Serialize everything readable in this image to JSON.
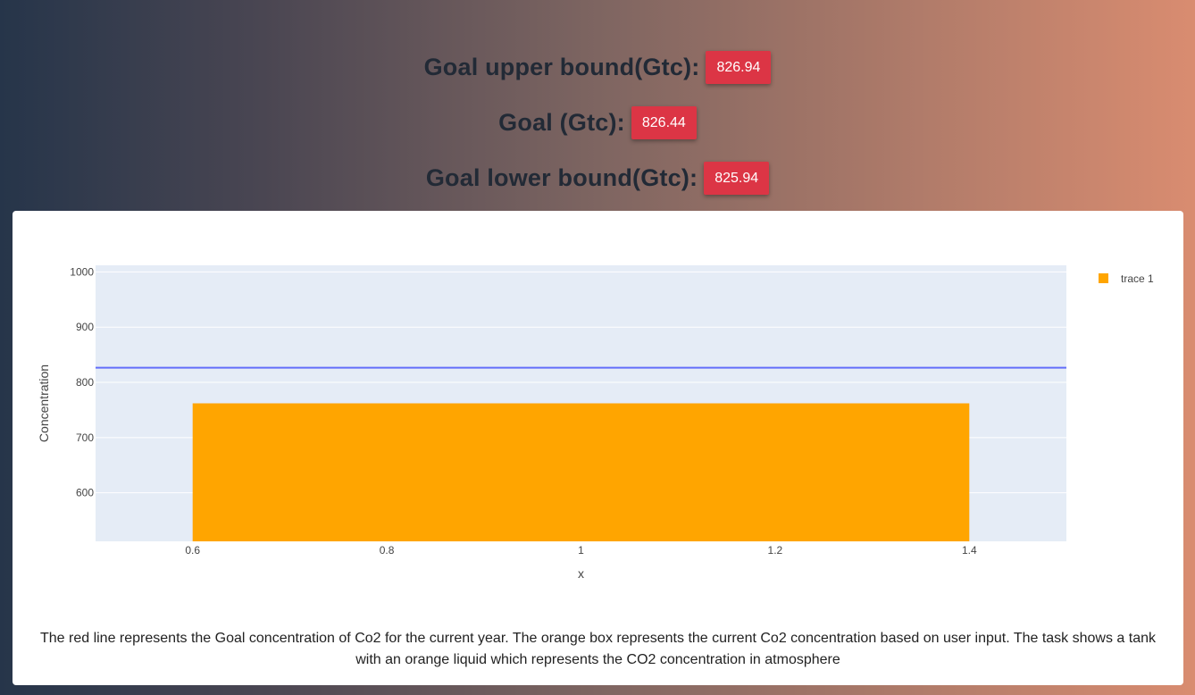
{
  "goals": [
    {
      "label": "Goal upper bound(Gtc):",
      "value": "826.94"
    },
    {
      "label": "Goal (Gtc):",
      "value": "826.44"
    },
    {
      "label": "Goal lower bound(Gtc):",
      "value": "825.94"
    }
  ],
  "colors": {
    "badge": "#dc3545",
    "bar": "#ffa500",
    "goal_line": "#636efa",
    "plot_bg": "#e5ecf6"
  },
  "chart_data": {
    "type": "bar",
    "x": [
      1
    ],
    "series": [
      {
        "name": "trace 1",
        "values": [
          762
        ],
        "color": "#ffa500"
      }
    ],
    "bar_range": [
      0.6,
      1.4
    ],
    "hline": {
      "y": 826.44,
      "color": "#636efa"
    },
    "xlabel": "x",
    "ylabel": "Concentration",
    "xlim": [
      0.5,
      1.5
    ],
    "ylim": [
      512,
      1012
    ],
    "xticks": [
      0.6,
      0.8,
      1,
      1.2,
      1.4
    ],
    "xtick_labels": [
      "0.6",
      "0.8",
      "1",
      "1.2",
      "1.4"
    ],
    "yticks": [
      600,
      700,
      800,
      900,
      1000
    ],
    "ytick_labels": [
      "600",
      "700",
      "800",
      "900",
      "1000"
    ],
    "grid": true,
    "legend": "top-right"
  },
  "caption": "The red line represents the Goal concentration of Co2 for the current year. The orange box represents the current Co2 concentration based on user input. The task shows a tank with an orange liquid which represents the CO2 concentration in atmosphere"
}
